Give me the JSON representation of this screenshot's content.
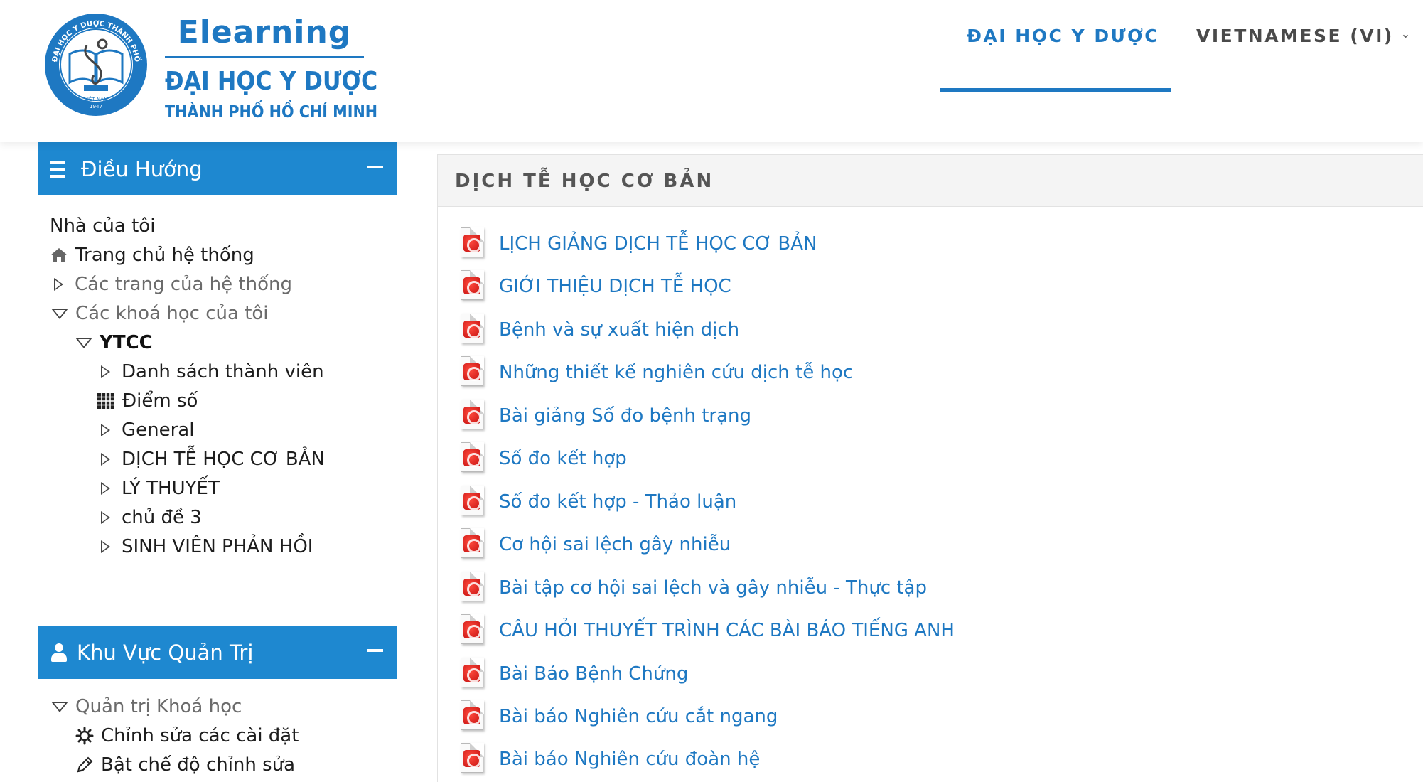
{
  "header": {
    "logo": {
      "elearning": "Elearning",
      "university": "ĐẠI HỌC Y DƯỢC",
      "city": "THÀNH PHỐ HỒ CHÍ MINH",
      "seal_text": "ĐẠI HỌC Y DƯỢC THÀNH PHỐ HỒ CHÍ MINH",
      "seal_country": "VIỆT NAM",
      "seal_year": "1947"
    },
    "nav_university": "ĐẠI HỌC Y DƯỢC",
    "nav_language": "VIETNAMESE (VI)"
  },
  "navigation_block": {
    "title": "Điều Hướng",
    "items": [
      {
        "label": "Nhà của tôi"
      },
      {
        "label": "Trang chủ hệ thống"
      },
      {
        "label": "Các trang của hệ thống"
      },
      {
        "label": "Các khoá học của tôi"
      },
      {
        "label": "YTCC"
      },
      {
        "label": "Danh sách thành viên"
      },
      {
        "label": "Điểm số"
      },
      {
        "label": "General"
      },
      {
        "label": "DỊCH TỄ HỌC CƠ BẢN"
      },
      {
        "label": "LÝ THUYẾT"
      },
      {
        "label": "chủ đề 3"
      },
      {
        "label": "SINH VIÊN PHẢN HỒI"
      }
    ]
  },
  "admin_block": {
    "title": "Khu Vực Quản Trị",
    "items": [
      {
        "label": "Quản trị Khoá học"
      },
      {
        "label": "Chỉnh sửa các cài đặt"
      },
      {
        "label": "Bật chế độ chỉnh sửa"
      }
    ]
  },
  "main": {
    "section_title": "DỊCH TỄ HỌC CƠ BẢN",
    "resources": [
      {
        "label": "LỊCH GIẢNG DỊCH TỄ HỌC CƠ BẢN",
        "icon": "pdf-icon"
      },
      {
        "label": "GIỚI THIỆU DỊCH TỄ HỌC",
        "icon": "pdf-icon"
      },
      {
        "label": "Bệnh và sự xuất hiện dịch",
        "icon": "pdf-icon"
      },
      {
        "label": "Những thiết kế nghiên cứu dịch tễ học",
        "icon": "pdf-icon"
      },
      {
        "label": "Bài giảng Số đo bệnh trạng",
        "icon": "pdf-icon"
      },
      {
        "label": "Số đo kết hợp",
        "icon": "pdf-icon"
      },
      {
        "label": "Số đo kết hợp - Thảo luận",
        "icon": "pdf-icon"
      },
      {
        "label": "Cơ hội sai lệch gây nhiễu",
        "icon": "pdf-icon"
      },
      {
        "label": "Bài tập cơ hội sai lệch và gây nhiễu - Thực tập",
        "icon": "pdf-icon"
      },
      {
        "label": "CÂU HỎI THUYẾT TRÌNH CÁC BÀI BÁO TIẾNG ANH",
        "icon": "pdf-icon"
      },
      {
        "label": "Bài Báo Bệnh Chứng",
        "icon": "pdf-icon"
      },
      {
        "label": "Bài báo Nghiên cứu cắt ngang",
        "icon": "pdf-icon"
      },
      {
        "label": "Bài báo Nghiên cứu đoàn hệ",
        "icon": "pdf-icon"
      }
    ]
  },
  "colors": {
    "brand_blue": "#1e78c2",
    "block_header_blue": "#1e88d0",
    "pdf_red": "#d01818"
  }
}
